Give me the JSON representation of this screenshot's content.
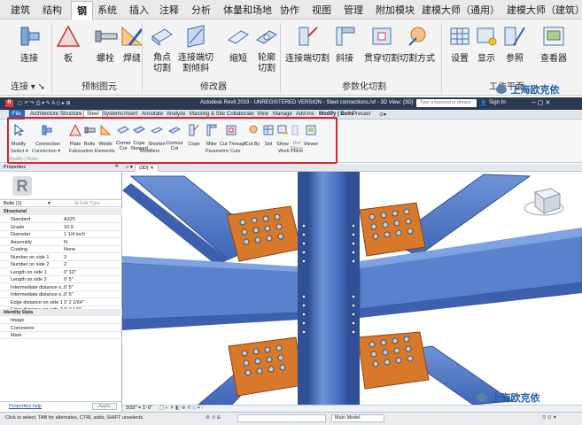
{
  "cn_ribbon": {
    "tabs": [
      "建筑",
      "结构",
      "钢",
      "系统",
      "插入",
      "注释",
      "分析",
      "体量和场地",
      "协作",
      "视图",
      "管理",
      "附加模块",
      "建模大师（通用）",
      "建模大师（建筑）"
    ],
    "active_tab": "钢",
    "tools": [
      "连接",
      "板",
      "螺栓",
      "焊缝",
      "角点切割",
      "连接端切割倾斜",
      "缩短",
      "轮廓切割",
      "连接端切割",
      "斜接",
      "贯穿切割",
      "切割方式",
      "设置",
      "显示",
      "参照",
      "查看器"
    ],
    "groups": [
      "连接",
      "预制图元",
      "修改器",
      "参数化切割",
      "工作平面"
    ]
  },
  "watermark": {
    "top": "上海欧克依",
    "bottom": "上海欧克依"
  },
  "revit": {
    "title": "Autodesk Revit 2019 - UNREGISTERED VERSION - Steel connections.rvt - 3D View: {3D}",
    "search_placeholder": "Type a keyword or phrase",
    "sign_in": "Sign In",
    "tabs": [
      "File",
      "Architecture",
      "Structure",
      "Steel",
      "Systems",
      "Insert",
      "Annotate",
      "Analyze",
      "Massing & Site",
      "Collaborate",
      "View",
      "Manage",
      "Add-Ins",
      "Modify | Bolts",
      "Precast"
    ],
    "tools": [
      "Modify",
      "Connection",
      "Plate",
      "Bolts",
      "Welds",
      "Corner Cut",
      "Cope Skewed",
      "Shorten",
      "Contour Cut",
      "Cope",
      "Miter",
      "Cut Through",
      "Cut By",
      "Set",
      "Show",
      "Ref Plane",
      "Viewer"
    ],
    "groups": [
      "Select ▾",
      "Connection ▾",
      "Fabrication Elements",
      "Modifiers",
      "Parametric Cuts",
      "Work Plane"
    ],
    "modify_bar": "Modify | Bolts"
  },
  "properties": {
    "header": "Properties",
    "type_selector": "Bolts (1)",
    "edit_type": "Edit Type",
    "sections": {
      "structural": "Structural",
      "identity": "Identity Data"
    },
    "rows": [
      {
        "k": "Standard",
        "v": "A325"
      },
      {
        "k": "Grade",
        "v": "10.9"
      },
      {
        "k": "Diameter",
        "v": "1 1/4 inch"
      },
      {
        "k": "Assembly",
        "v": "N"
      },
      {
        "k": "Coating",
        "v": "None"
      },
      {
        "k": "Number on side 1",
        "v": "3"
      },
      {
        "k": "Number on side 2",
        "v": "2"
      },
      {
        "k": "Length on side 1",
        "v": "0'  10\""
      },
      {
        "k": "Length on side 2",
        "v": "0'  5\""
      },
      {
        "k": "Intermediate distance o...",
        "v": "0'  5\""
      },
      {
        "k": "Intermediate distance o...",
        "v": "0'  5\""
      },
      {
        "k": "Edge distance on side 1",
        "v": "0'  2 1/64\""
      },
      {
        "k": "Edge distance on side 2",
        "v": "0'  2 1/2\""
      }
    ],
    "identity_rows": [
      {
        "k": "Image",
        "v": ""
      },
      {
        "k": "Comments",
        "v": ""
      },
      {
        "k": "Mark",
        "v": ""
      }
    ],
    "help": "Properties help",
    "apply": "Apply"
  },
  "view": {
    "tab_label": "{3D}",
    "scale": "3/32\" = 1'-0\""
  },
  "status": {
    "message": "Click to select, TAB for alternates, CTRL adds, SHIFT unselects.",
    "model": "Main Model"
  },
  "colors": {
    "beam": "#4a74c5",
    "beam_dark": "#2f4f97",
    "plate": "#d8782a",
    "highlight": "#d8262b"
  }
}
